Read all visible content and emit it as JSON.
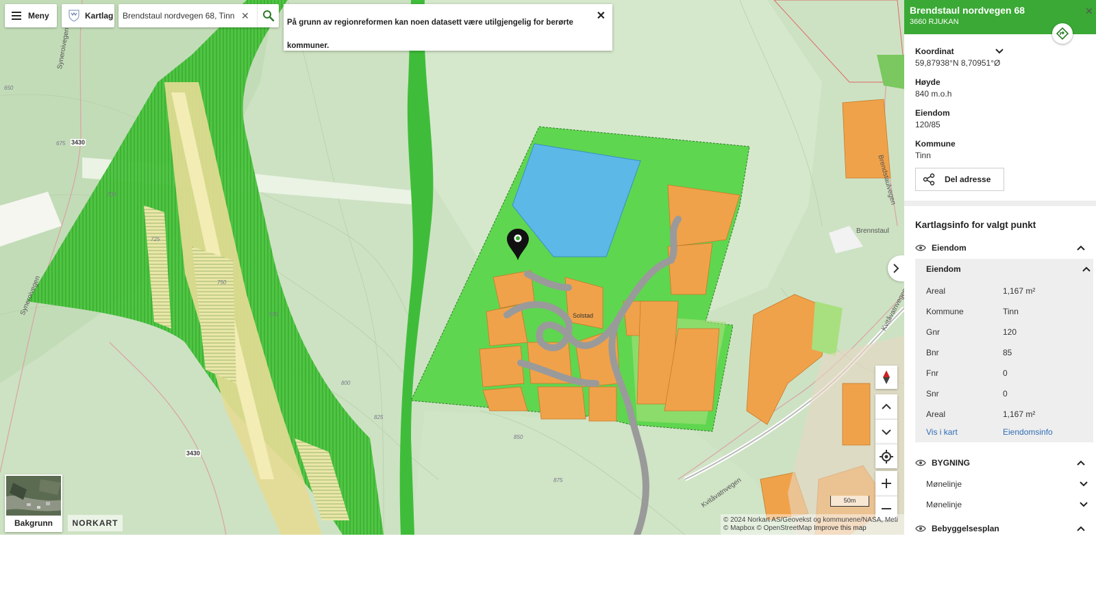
{
  "toolbar": {
    "menu_label": "Meny",
    "layers_label": "Kartlag"
  },
  "search": {
    "value": "Brendstaul nordvegen 68, Tinn"
  },
  "notice": {
    "text": "På grunn av regionreformen kan noen datasett være utilgjengelig for berørte kommuner."
  },
  "map_labels": {
    "road_code_1": "3430",
    "road_code_2": "3430",
    "road_syn_1": "Syneroivegen",
    "road_syn_2": "Syneroivegen",
    "road_kvitavatn": "Kvitåvatnvegen",
    "road_kvitavatn_2": "Kvitåvatnvegen",
    "road_brendstaul": "Brendstaulvegen",
    "place_brennstaul": "Brennstaul",
    "place_solstad": "Solstad",
    "contour_650": "650",
    "contour_675": "675",
    "contour_700": "700",
    "contour_725": "725",
    "contour_750": "750",
    "contour_775": "775",
    "contour_800": "800",
    "contour_825": "825",
    "contour_850": "850",
    "contour_875": "875"
  },
  "scale": "50m",
  "attribution": {
    "line1": "© 2024 Norkart AS/Geovekst og kommunene/NASA, Meti",
    "line2": "© Mapbox © OpenStreetMap",
    "improve": "Improve this map"
  },
  "background_thumb": {
    "label": "Bakgrunn"
  },
  "logo_text": "NORKART",
  "panel": {
    "address": "Brendstaul nordvegen 68",
    "postal": "3660 RJUKAN",
    "coord_label": "Koordinat",
    "coord_value": "59,87938°N 8,70951°Ø",
    "height_label": "Høyde",
    "height_value": "840 m.o.h",
    "property_label": "Eiendom",
    "property_value": "120/85",
    "municipality_label": "Kommune",
    "municipality_value": "Tinn",
    "share_label": "Del adresse",
    "layerinfo_title": "Kartlagsinfo for valgt punkt",
    "layer_eiendom": "Eiendom",
    "sub_eiendom": "Eiendom",
    "rows": [
      {
        "k": "Areal",
        "v": "1,167 m²"
      },
      {
        "k": "Kommune",
        "v": "Tinn"
      },
      {
        "k": "Gnr",
        "v": "120"
      },
      {
        "k": "Bnr",
        "v": "85"
      },
      {
        "k": "Fnr",
        "v": "0"
      },
      {
        "k": "Snr",
        "v": "0"
      },
      {
        "k": "Areal",
        "v": "1,167 m²"
      }
    ],
    "link_map": "Vis i kart",
    "link_info": "Eiendomsinfo",
    "layer_bygning": "BYGNING",
    "bygning_rows": [
      "Mønelinje",
      "Mønelinje"
    ],
    "layer_bebyggelse": "Bebyggelsesplan"
  },
  "colors": {
    "brand_green": "#3aa935",
    "link_blue": "#2f6db5",
    "zone_green": "#5fd64f",
    "plot_orange": "#f0a24a",
    "lake_blue": "#5cb8e6"
  }
}
